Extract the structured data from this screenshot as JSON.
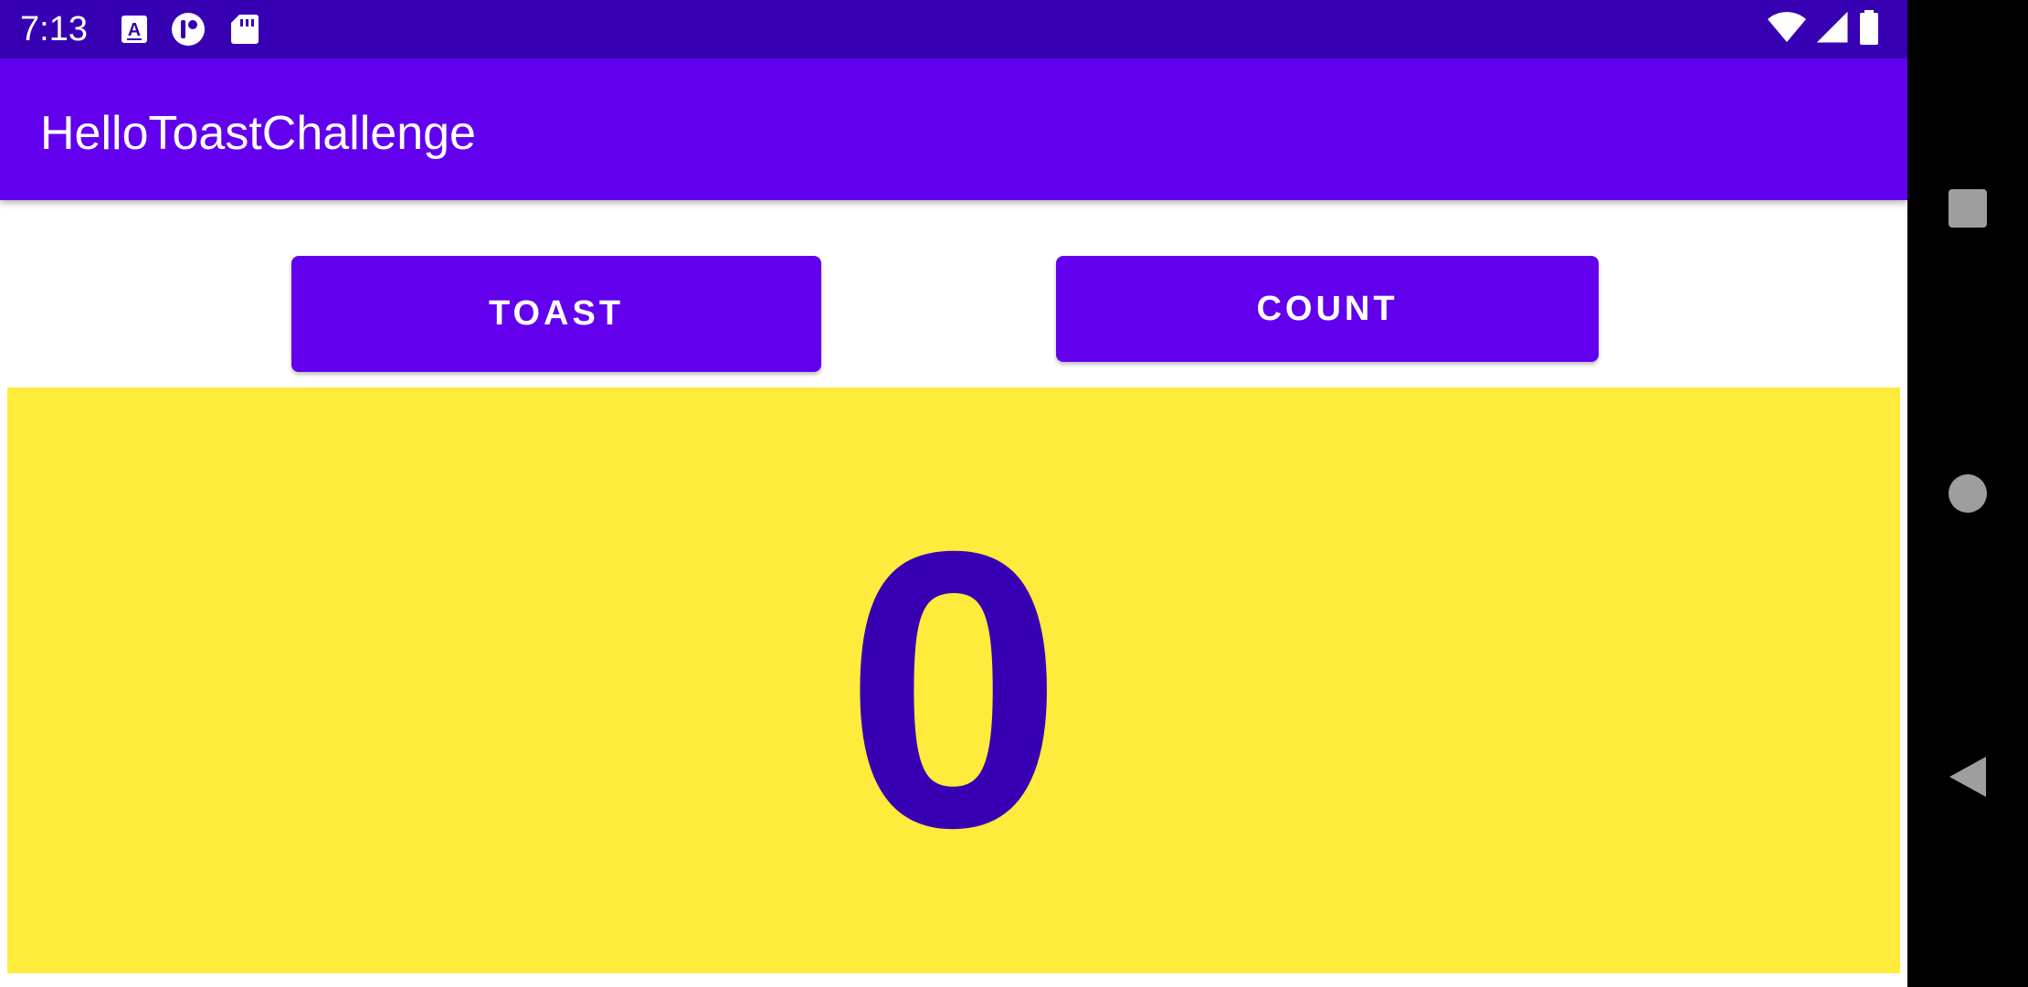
{
  "status_bar": {
    "time": "7:13",
    "left_icons": [
      "text-a-icon",
      "notification-toggle-icon",
      "sd-card-icon"
    ],
    "right_icons": [
      "wifi-icon",
      "cell-signal-icon",
      "battery-icon"
    ],
    "background": "#3700b3"
  },
  "app_bar": {
    "title": "HelloToastChallenge",
    "background": "#6200ee"
  },
  "buttons": {
    "toast_label": "TOAST",
    "count_label": "COUNT",
    "color": "#6200ee"
  },
  "counter": {
    "value": "0",
    "background": "#ffeb3b",
    "text_color": "#3700b3"
  },
  "nav_bar": {
    "icons": [
      "recents-square-icon",
      "home-circle-icon",
      "back-triangle-icon"
    ]
  }
}
